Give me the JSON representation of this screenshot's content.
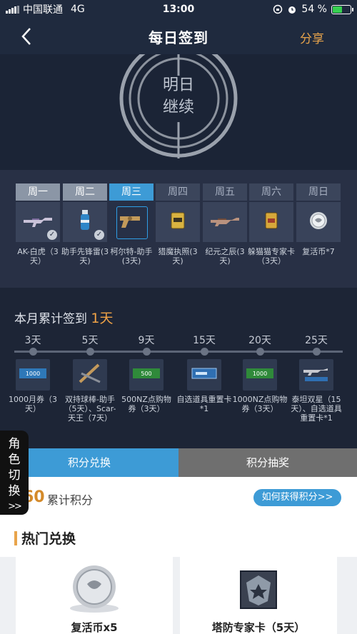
{
  "status_bar": {
    "carrier": "中国联通",
    "network": "4G",
    "time": "13:00",
    "battery": "54 %",
    "battery_level": 0.54
  },
  "nav": {
    "title": "每日签到",
    "share": "分享"
  },
  "hero": {
    "line1": "明日",
    "line2": "继续"
  },
  "week": [
    {
      "day": "周一",
      "reward": "AK-白虎（3天）",
      "state": "signed",
      "icon": "rifle-icon"
    },
    {
      "day": "周二",
      "reward": "助手先锋雷(3天)",
      "state": "signed",
      "icon": "grenade-icon"
    },
    {
      "day": "周三",
      "reward": "柯尔特-助手(3天)",
      "state": "today",
      "icon": "pistol-icon"
    },
    {
      "day": "周四",
      "reward": "猎魔执照(3天)",
      "state": "future",
      "icon": "license-card-icon"
    },
    {
      "day": "周五",
      "reward": "纪元之辰(3天)",
      "state": "future",
      "icon": "shotgun-icon"
    },
    {
      "day": "周六",
      "reward": "躲猫猫专家卡（3天）",
      "state": "future",
      "icon": "expert-card-icon"
    },
    {
      "day": "周日",
      "reward": "复活币*7",
      "state": "future",
      "icon": "revive-coin-icon"
    }
  ],
  "monthly": {
    "title_prefix": "本月累计签到",
    "count": "1天",
    "milestones": [
      {
        "days": "3天",
        "reward": "1000月券（3天）",
        "icon": "voucher-1000-icon"
      },
      {
        "days": "5天",
        "reward": "双持球棒-助手（5天）、Scar-天王（7天）",
        "icon": "bat-rifle-icon"
      },
      {
        "days": "9天",
        "reward": "500NZ点购物券（3天）",
        "icon": "voucher-500-icon"
      },
      {
        "days": "15天",
        "reward": "自选道具重置卡*1",
        "icon": "reset-card-icon"
      },
      {
        "days": "20天",
        "reward": "1000NZ点购物券（3天）",
        "icon": "voucher-1000nz-icon"
      },
      {
        "days": "25天",
        "reward": "泰坦双星（15天）、自选道具重置卡*1",
        "icon": "titan-rifle-icon"
      }
    ]
  },
  "tabs": {
    "exchange": "积分兑换",
    "lottery": "积分抽奖"
  },
  "side_tab": {
    "label": "角色切换",
    "arrow": ">>"
  },
  "points": {
    "value": "60",
    "label": "累计积分",
    "how_button": "如何获得积分>>"
  },
  "hot": {
    "title": "热门兑换",
    "items": [
      {
        "name": "复活币x5",
        "icon": "revive-coin-icon"
      },
      {
        "name": "塔防专家卡（5天）",
        "icon": "tower-defense-card-icon"
      }
    ]
  },
  "colors": {
    "accent": "#3d9bd6",
    "orange": "#e8a44b",
    "dark_bg": "#1d2536"
  }
}
